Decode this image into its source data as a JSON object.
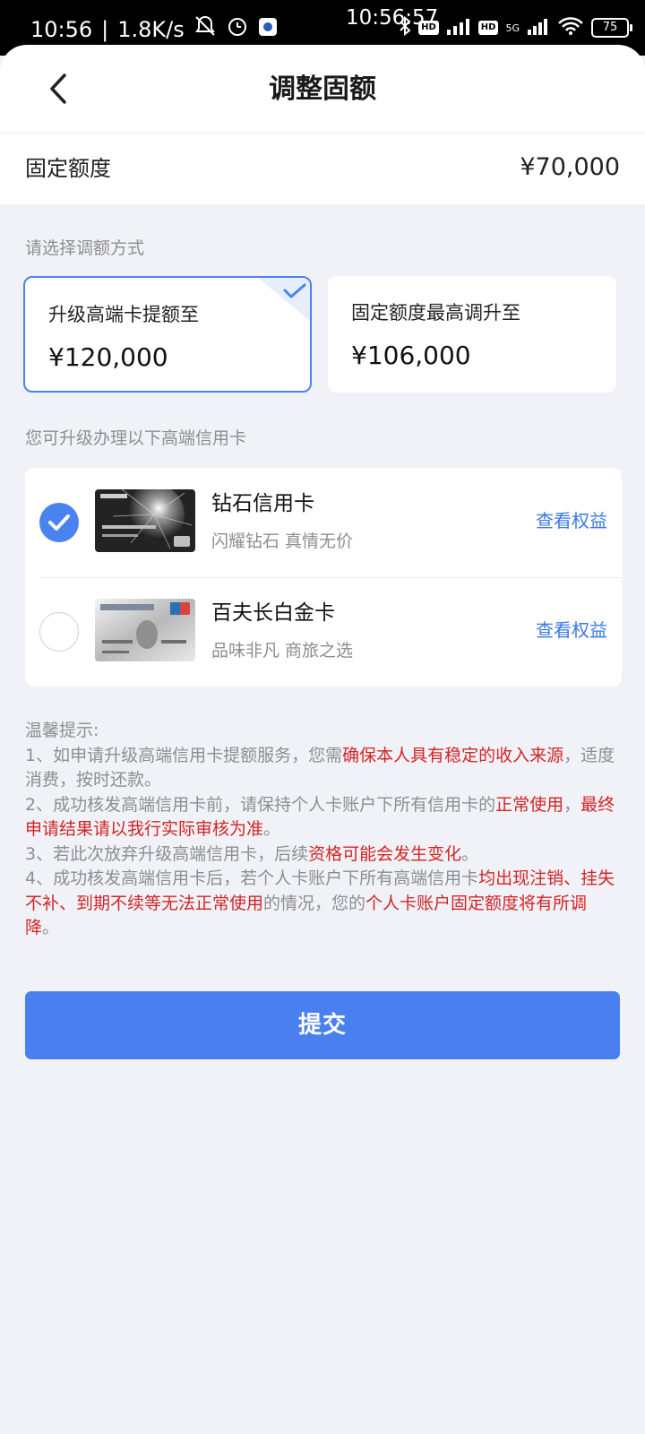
{
  "status_bar": {
    "time": "10:56",
    "speed": "1.8K/s",
    "center_clock": "10:56:57",
    "network_1": "HD",
    "network_2": "HD",
    "network_5g": "5G",
    "battery": "75"
  },
  "header": {
    "title": "调整固额",
    "back_icon": "chevron-left-icon"
  },
  "fixed_limit": {
    "label": "固定额度",
    "value": "¥70,000"
  },
  "adjust_section": {
    "hint": "请选择调额方式",
    "options": [
      {
        "label": "升级高端卡提额至",
        "value": "¥120,000",
        "selected": true
      },
      {
        "label": "固定额度最高调升至",
        "value": "¥106,000",
        "selected": false
      }
    ]
  },
  "cards_section": {
    "hint": "您可升级办理以下高端信用卡",
    "cards": [
      {
        "name": "钻石信用卡",
        "slogan": "闪耀钻石 真情无价",
        "link": "查看权益",
        "selected": true
      },
      {
        "name": "百夫长白金卡",
        "slogan": "品味非凡 商旅之选",
        "link": "查看权益",
        "selected": false
      }
    ]
  },
  "tips": {
    "title": "温馨提示:",
    "items": [
      {
        "a": "1、如申请升级高端信用卡提额服务，您需",
        "b": "确保本人具有稳定的收入来源",
        "c": "，适度消费，按时还款。"
      },
      {
        "a": "2、成功核发高端信用卡前，请保持个人卡账户下所有信用卡的",
        "b": "正常使用",
        "c": "，",
        "d": "最终申请结果请以我行实际审核为准",
        "e": "。"
      },
      {
        "a": "3、若此次放弃升级高端信用卡，后续",
        "b": "资格可能会发生变化",
        "c": "。"
      },
      {
        "a": "4、成功核发高端信用卡后，若个人卡账户下所有高端信用卡",
        "b": "均出现注销、挂失不补、到期不续等无法正常使用",
        "c": "的情况，您的",
        "d": "个人卡账户固定额度将有所调降",
        "e": "。"
      }
    ]
  },
  "submit": {
    "label": "提交"
  },
  "colors": {
    "accent": "#4a7ff0",
    "link": "#3b78e7",
    "warning": "#d42424",
    "background": "#f1f2f7"
  }
}
